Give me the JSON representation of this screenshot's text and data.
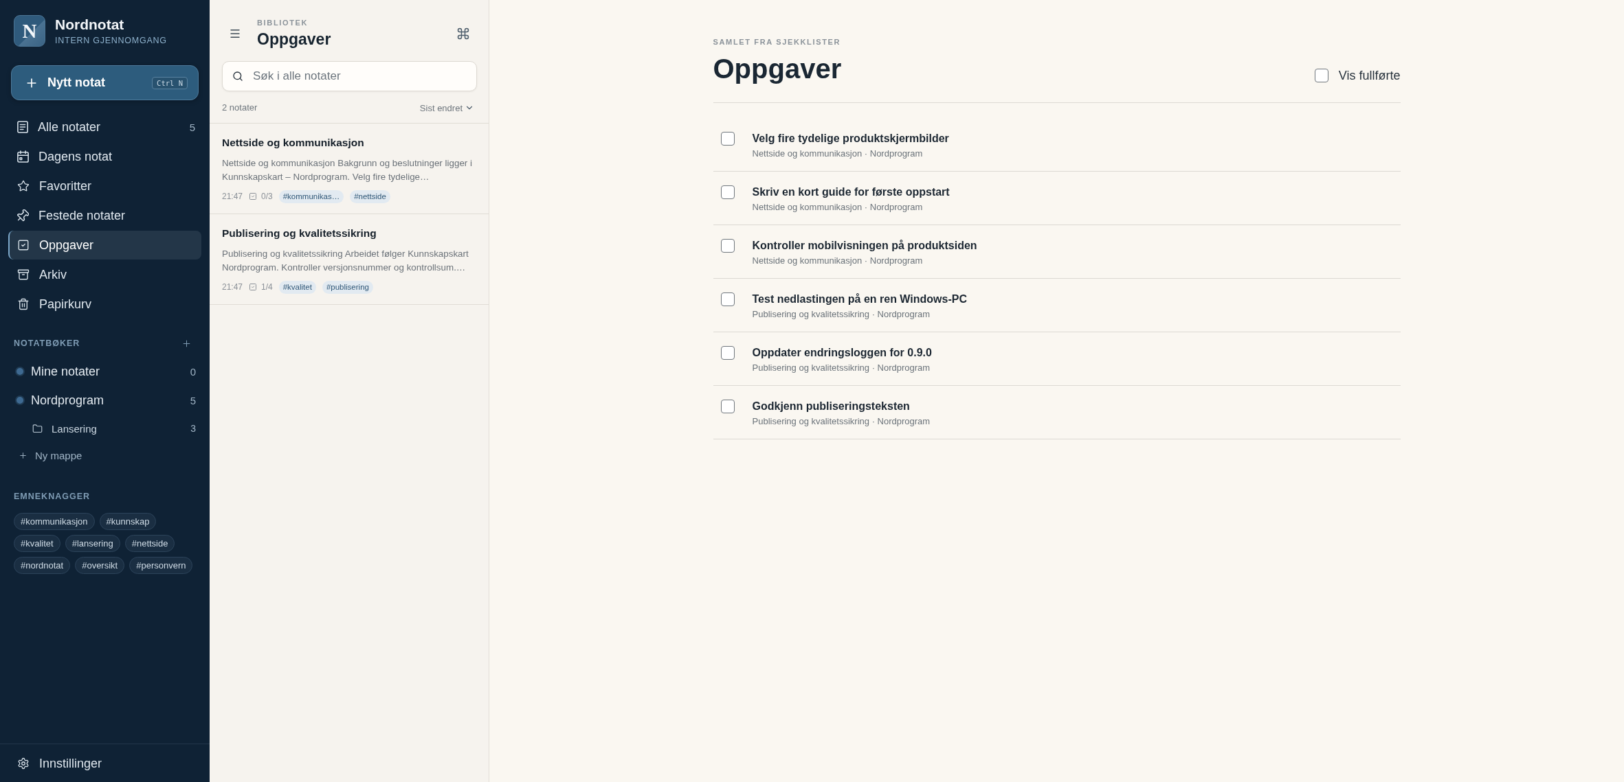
{
  "app": {
    "logo_letter": "N",
    "name": "Nordnotat",
    "subtitle": "INTERN GJENNOMGANG"
  },
  "new_note": {
    "label": "Nytt notat",
    "shortcut": "Ctrl N"
  },
  "nav": [
    {
      "label": "Alle notater",
      "count": "5",
      "selected": false
    },
    {
      "label": "Dagens notat",
      "selected": false
    },
    {
      "label": "Favoritter",
      "selected": false
    },
    {
      "label": "Festede notater",
      "selected": false
    },
    {
      "label": "Oppgaver",
      "selected": true
    },
    {
      "label": "Arkiv",
      "selected": false
    },
    {
      "label": "Papirkurv",
      "selected": false
    }
  ],
  "notebooks": {
    "title": "NOTATBØKER",
    "items": [
      {
        "name": "Mine notater",
        "count": "0"
      },
      {
        "name": "Nordprogram",
        "count": "5",
        "children": [
          {
            "name": "Lansering",
            "count": "3"
          }
        ]
      }
    ],
    "new_folder": "Ny mappe"
  },
  "tags": {
    "title": "EMNEKNAGGER",
    "items": [
      "#kommunikasjon",
      "#kunnskap",
      "#kvalitet",
      "#lansering",
      "#nettside",
      "#nordnotat",
      "#oversikt",
      "#personvern"
    ]
  },
  "settings": {
    "label": "Innstillinger"
  },
  "list_panel": {
    "eyebrow": "BIBLIOTEK",
    "title": "Oppgaver",
    "search": {
      "placeholder": "Søk i alle notater"
    },
    "count": "2 notater",
    "sort": "Sist endret",
    "notes": [
      {
        "title": "Nettside og kommunikasjon",
        "preview": "Nettside og kommunikasjon Bakgrunn og beslutninger ligger i Kunnskapskart – Nordprogram. Velg fire tydelige…",
        "time": "21:47",
        "tasks": "0/3",
        "tags": [
          "#kommunikas…",
          "#nettside"
        ],
        "selected": false
      },
      {
        "title": "Publisering og kvalitetssikring",
        "preview": "Publisering og kvalitetssikring Arbeidet følger Kunnskapskart Nordprogram. Kontroller versjonsnummer og kontrollsum.…",
        "time": "21:47",
        "tasks": "1/4",
        "tags": [
          "#kvalitet",
          "#publisering"
        ],
        "selected": false
      }
    ]
  },
  "main": {
    "eyebrow": "SAMLET FRA SJEKKLISTER",
    "title": "Oppgaver",
    "show_completed": {
      "label": "Vis fullførte",
      "checked": false
    },
    "tasks": [
      {
        "title": "Velg fire tydelige produktskjermbilder",
        "source": "Nettside og kommunikasjon · Nordprogram",
        "checked": false
      },
      {
        "title": "Skriv en kort guide for første oppstart",
        "source": "Nettside og kommunikasjon · Nordprogram",
        "checked": false
      },
      {
        "title": "Kontroller mobilvisningen på produktsiden",
        "source": "Nettside og kommunikasjon · Nordprogram",
        "checked": false
      },
      {
        "title": "Test nedlastingen på en ren Windows-PC",
        "source": "Publisering og kvalitetssikring · Nordprogram",
        "checked": false
      },
      {
        "title": "Oppdater endringsloggen for 0.9.0",
        "source": "Publisering og kvalitetssikring · Nordprogram",
        "checked": false
      },
      {
        "title": "Godkjenn publiseringsteksten",
        "source": "Publisering og kvalitetssikring · Nordprogram",
        "checked": false
      }
    ]
  }
}
